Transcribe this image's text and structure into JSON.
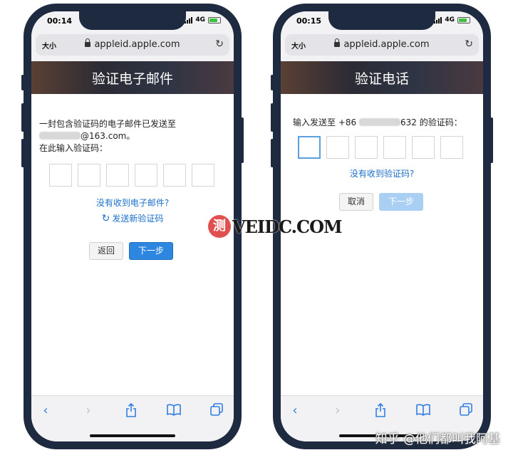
{
  "phone1": {
    "time": "00:14",
    "network": "4G",
    "text_size_label": "大小",
    "url": "appleid.apple.com",
    "banner_title": "验证电子邮件",
    "message_line1": "一封包含验证码的电子邮件已发送至",
    "email_suffix": "@163.com。",
    "prompt": "在此输入验证码：",
    "no_email_link": "没有收到电子邮件?",
    "resend_label": "发送新验证码",
    "back_button": "返回",
    "next_button": "下一步"
  },
  "phone2": {
    "time": "00:15",
    "network": "4G",
    "text_size_label": "大小",
    "url": "appleid.apple.com",
    "banner_title": "验证电话",
    "prompt_prefix": "输入发送至 +86",
    "prompt_suffix": "632 的验证码：",
    "no_code_link": "没有收到验证码?",
    "cancel_button": "取消",
    "next_button": "下一步"
  },
  "watermark": {
    "badge": "测",
    "text": "VEIDC.COM"
  },
  "credit": "知乎 @他们都叫我阿基",
  "colors": {
    "accent": "#2d86df",
    "link": "#1a6fc9",
    "frame": "#1e2a40"
  }
}
